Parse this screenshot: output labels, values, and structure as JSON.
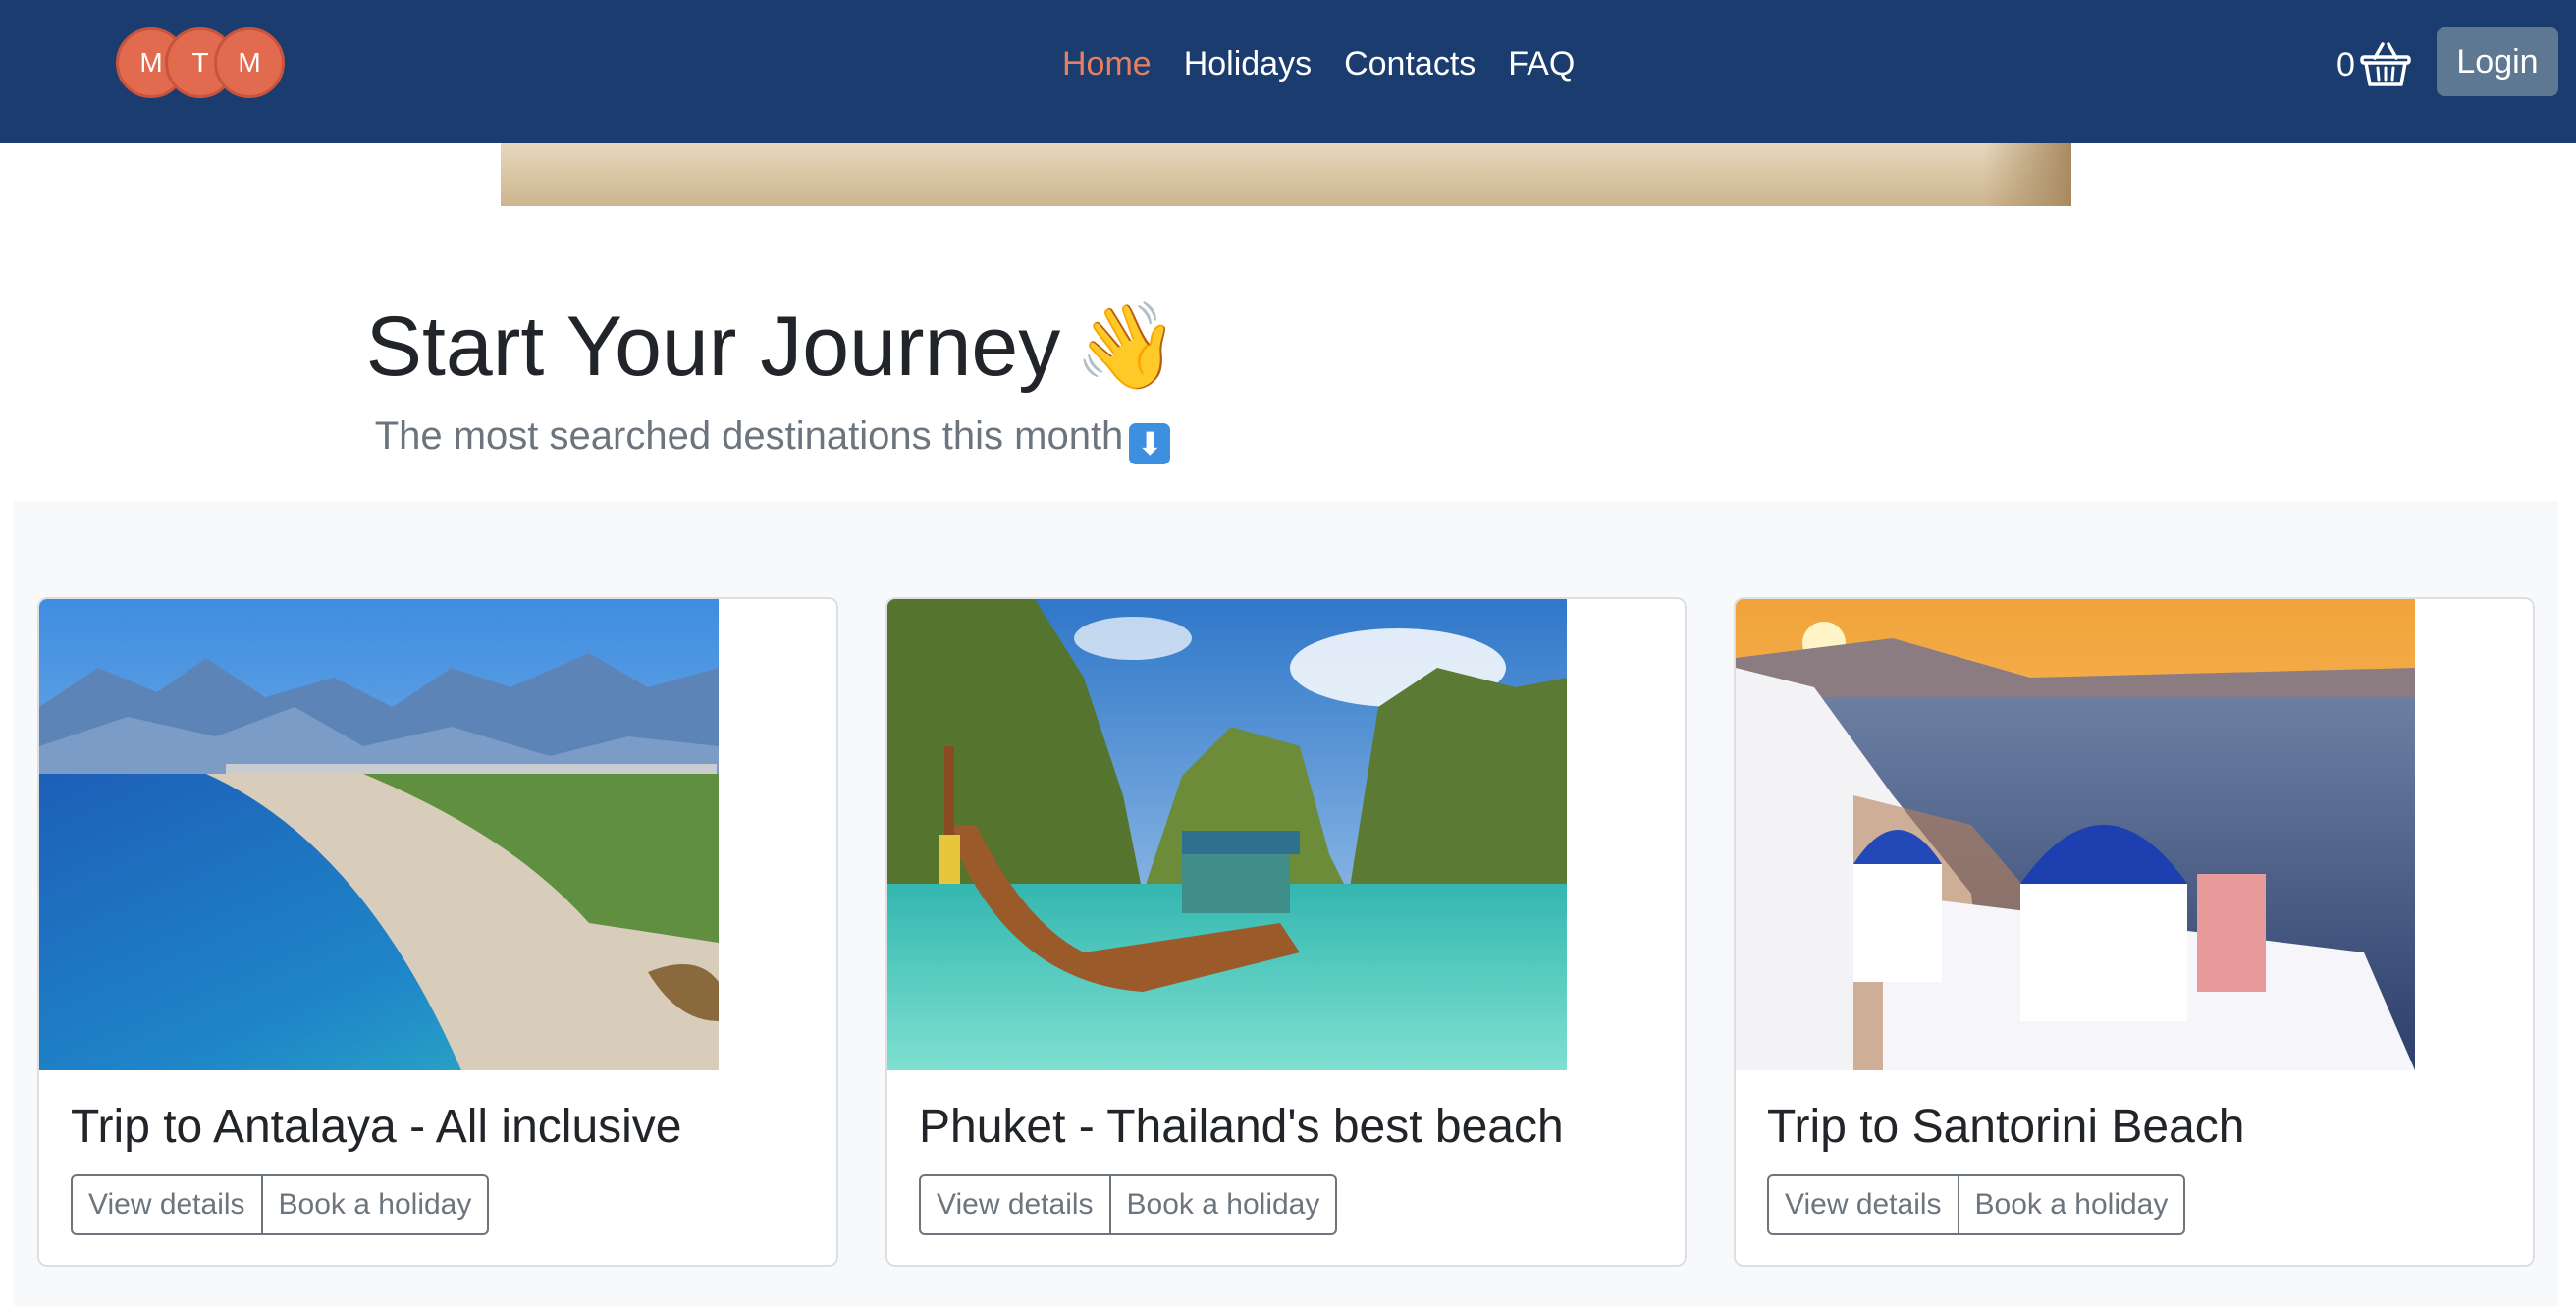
{
  "brand": {
    "letters": [
      "M",
      "T",
      "M"
    ]
  },
  "nav": {
    "links": [
      {
        "label": "Home",
        "active": true
      },
      {
        "label": "Holidays",
        "active": false
      },
      {
        "label": "Contacts",
        "active": false
      },
      {
        "label": "FAQ",
        "active": false
      }
    ],
    "cart_count": "0",
    "login_label": "Login"
  },
  "hero": {
    "title": "Start Your Journey",
    "title_emoji": "👋",
    "subtitle": "The most searched destinations this month",
    "subtitle_emoji": "⬇"
  },
  "cards": [
    {
      "title": "Trip to Antalaya - All inclusive",
      "btn_details": "View details",
      "btn_book": "Book a holiday"
    },
    {
      "title": "Phuket - Thailand's best beach",
      "btn_details": "View details",
      "btn_book": "Book a holiday"
    },
    {
      "title": "Trip to Santorini Beach",
      "btn_details": "View details",
      "btn_book": "Book a holiday"
    }
  ],
  "colors": {
    "navbar": "#1b3c6e",
    "accent": "#e16a4f",
    "active_link": "#e8805f",
    "login_button": "#5e7891",
    "section_bg": "#f8f9fa"
  }
}
